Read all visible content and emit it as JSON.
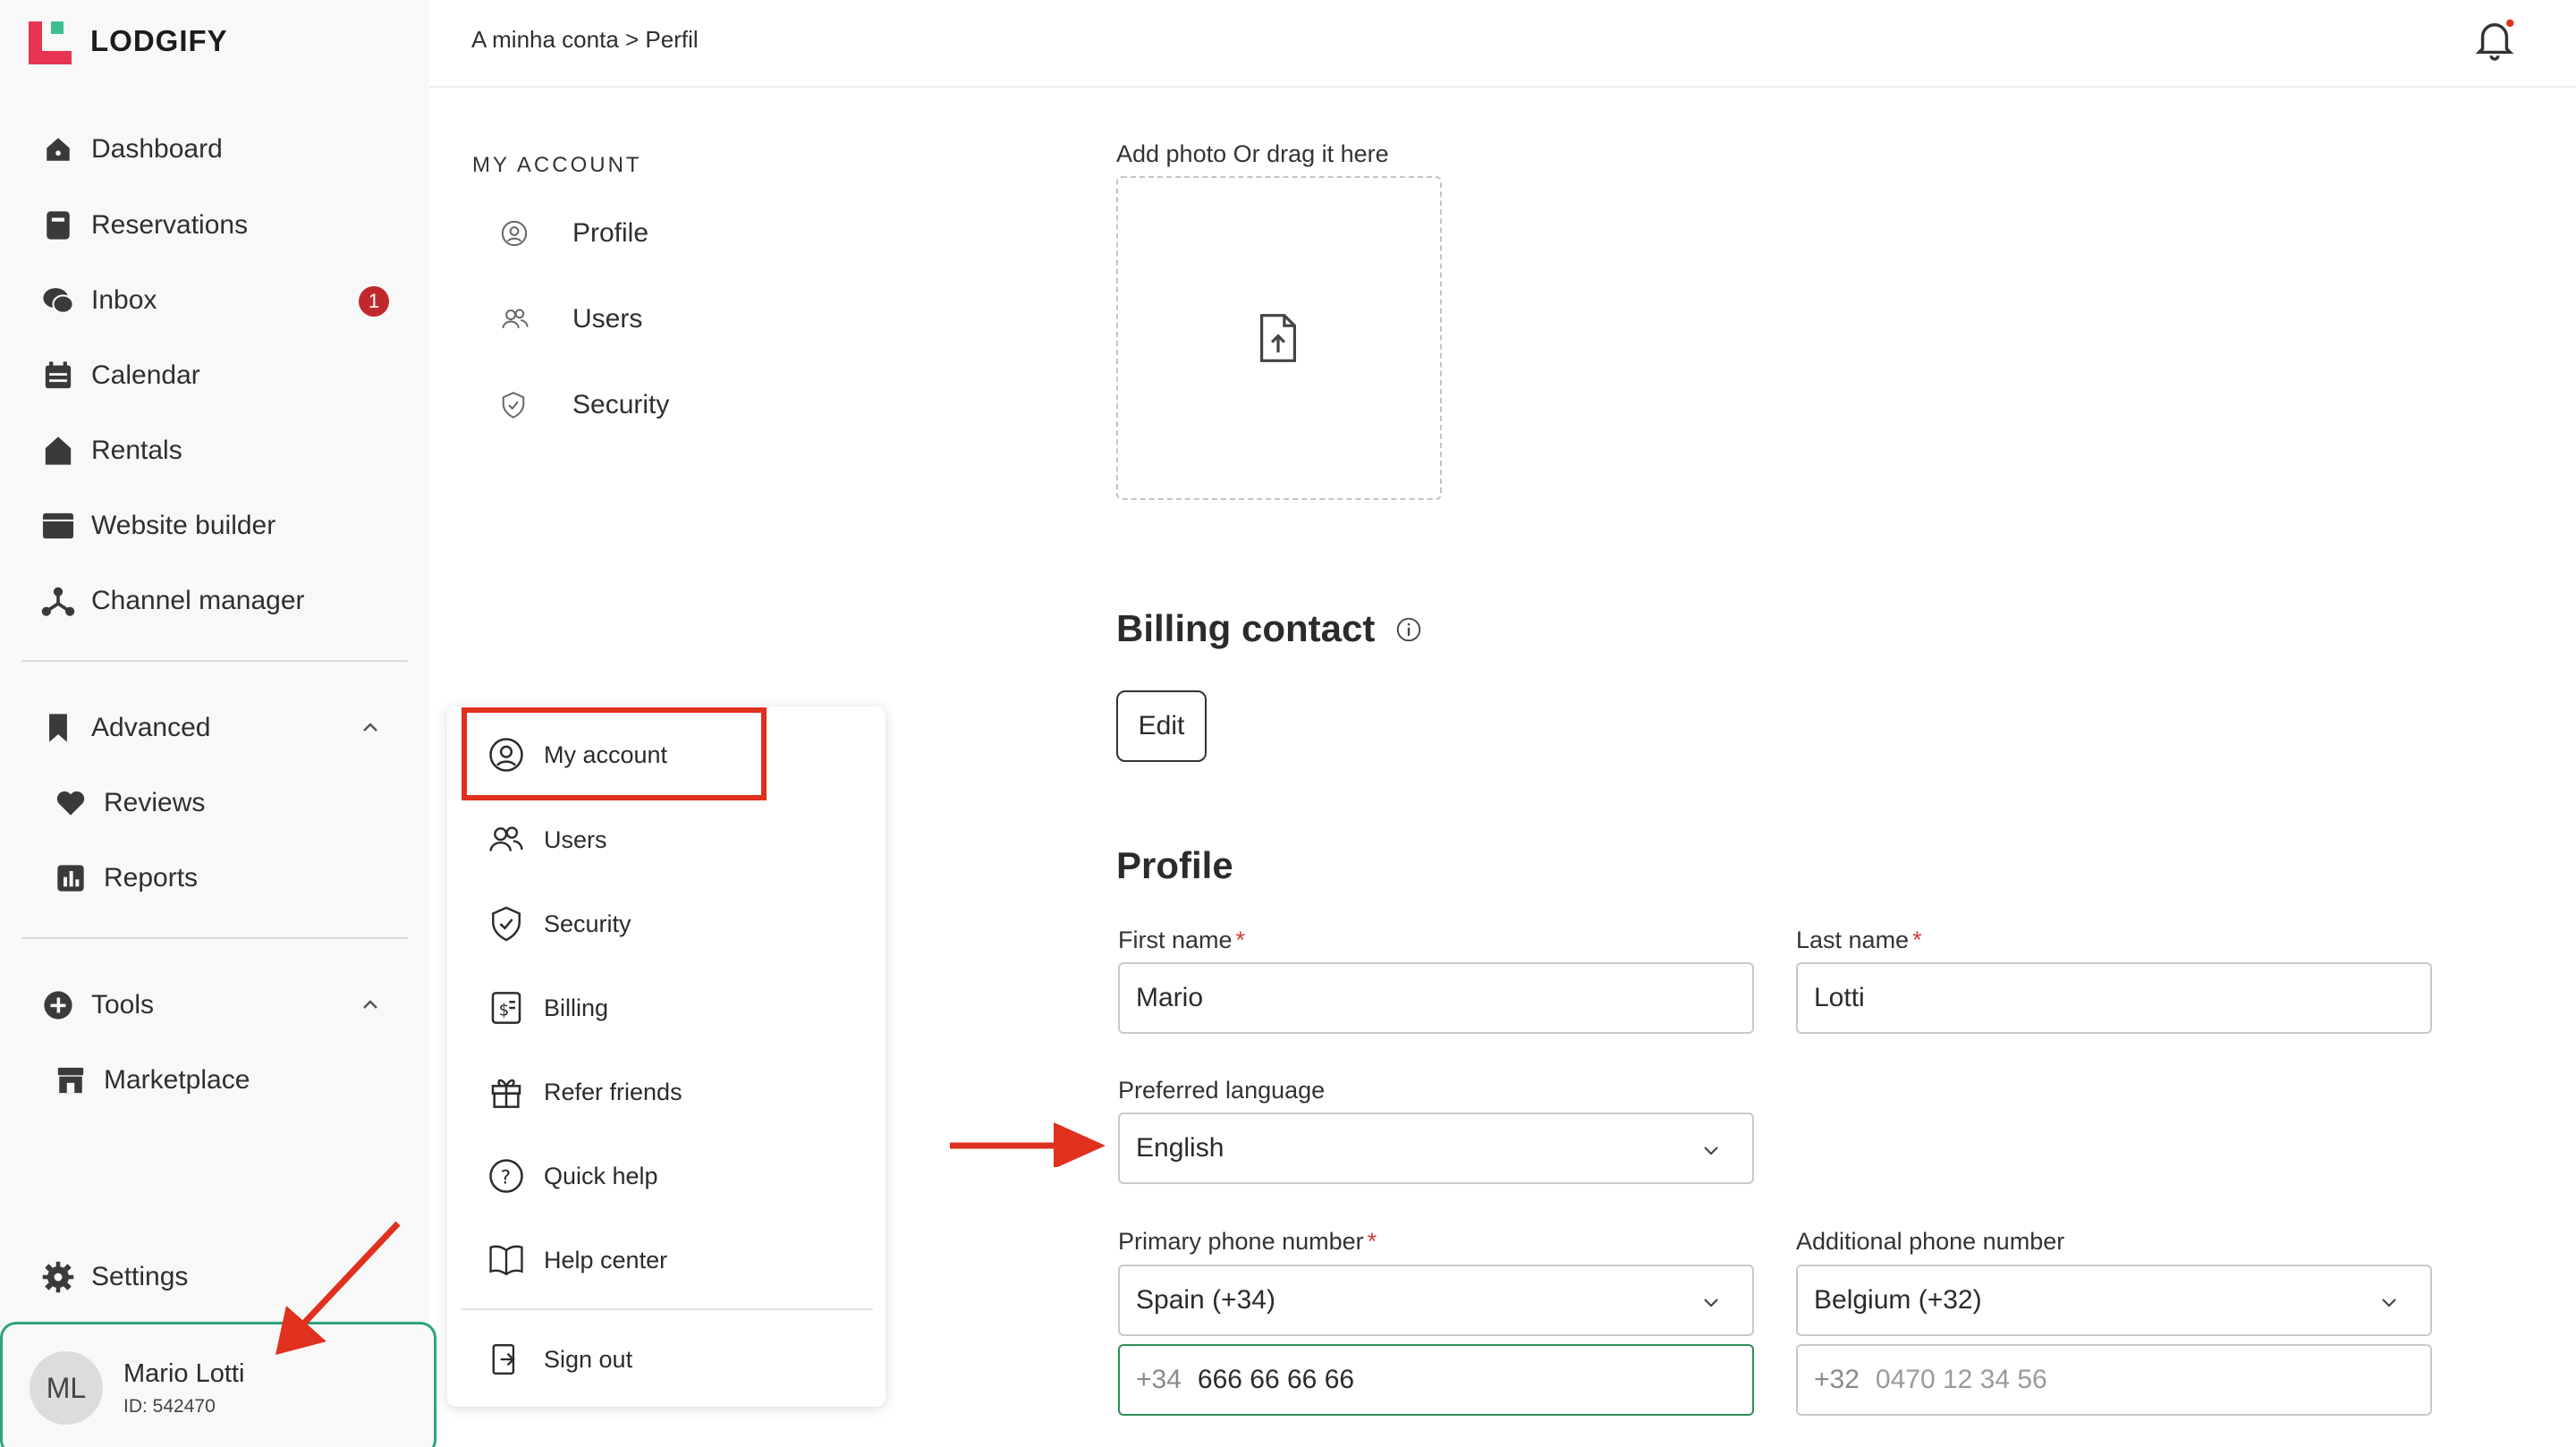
{
  "app": {
    "brand": "LODGIFY",
    "colors": {
      "brand_red": "#e63553",
      "brand_green": "#3fbf8f",
      "accent_green": "#2fa37a",
      "annotation_red": "#e0301e",
      "badge_red": "#c0282d"
    }
  },
  "header": {
    "breadcrumb": "A minha conta > Perfil",
    "notification_icon": "bell-icon"
  },
  "sidebar": {
    "items": [
      {
        "label": "Dashboard",
        "icon": "home-icon"
      },
      {
        "label": "Reservations",
        "icon": "book-icon"
      },
      {
        "label": "Inbox",
        "icon": "chat-icon",
        "badge": "1"
      },
      {
        "label": "Calendar",
        "icon": "calendar-icon"
      },
      {
        "label": "Rentals",
        "icon": "house-icon"
      },
      {
        "label": "Website builder",
        "icon": "browser-icon"
      },
      {
        "label": "Channel manager",
        "icon": "network-icon"
      }
    ],
    "advanced": {
      "label": "Advanced",
      "icon": "bookmark-icon",
      "items": [
        {
          "label": "Reviews",
          "icon": "heart-icon"
        },
        {
          "label": "Reports",
          "icon": "chart-icon"
        }
      ]
    },
    "tools": {
      "label": "Tools",
      "icon": "plus-circle-icon",
      "items": [
        {
          "label": "Marketplace",
          "icon": "store-icon"
        }
      ]
    },
    "settings": {
      "label": "Settings",
      "icon": "gear-icon"
    },
    "user": {
      "initials": "ML",
      "name": "Mario Lotti",
      "id": "ID: 542470"
    }
  },
  "account_nav": {
    "section": "MY ACCOUNT",
    "items": [
      {
        "label": "Profile",
        "icon": "user-circle-icon"
      },
      {
        "label": "Users",
        "icon": "users-icon"
      },
      {
        "label": "Security",
        "icon": "shield-icon"
      }
    ]
  },
  "user_menu": {
    "items": [
      {
        "label": "My account",
        "icon": "user-circle-icon"
      },
      {
        "label": "Users",
        "icon": "users-icon"
      },
      {
        "label": "Security",
        "icon": "shield-check-icon"
      },
      {
        "label": "Billing",
        "icon": "invoice-icon"
      },
      {
        "label": "Refer friends",
        "icon": "gift-icon"
      },
      {
        "label": "Quick help",
        "icon": "question-icon"
      },
      {
        "label": "Help center",
        "icon": "open-book-icon"
      }
    ],
    "sign_out": {
      "label": "Sign out",
      "icon": "sign-out-icon"
    }
  },
  "main": {
    "photo": {
      "label": "Add photo Or drag it here",
      "icon": "file-upload-icon"
    },
    "billing": {
      "title": "Billing contact",
      "edit_label": "Edit"
    },
    "profile": {
      "title": "Profile",
      "first_name": {
        "label": "First name",
        "required": "*",
        "value": "Mario"
      },
      "last_name": {
        "label": "Last name",
        "required": "*",
        "value": "Lotti"
      },
      "language": {
        "label": "Preferred language",
        "value": "English"
      },
      "primary_phone": {
        "label": "Primary phone number",
        "required": "*",
        "country": "Spain (+34)",
        "prefix": "+34",
        "number": "666 66 66 66"
      },
      "additional_phone": {
        "label": "Additional phone number",
        "country": "Belgium (+32)",
        "prefix": "+32",
        "placeholder": "0470 12 34 56"
      }
    }
  }
}
